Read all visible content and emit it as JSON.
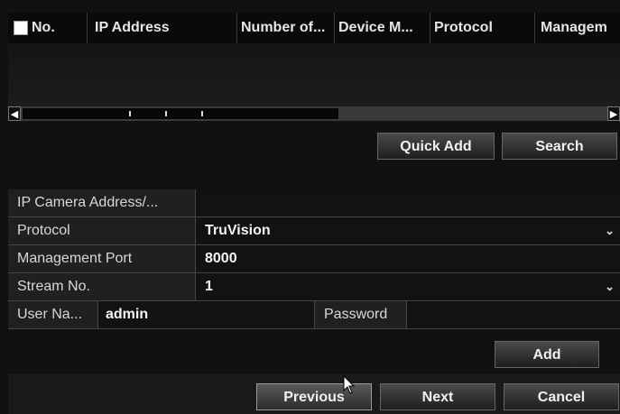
{
  "table": {
    "columns": [
      "No.",
      "IP Address",
      "Number of...",
      "Device M...",
      "Protocol",
      "Managem"
    ],
    "rows": []
  },
  "scroll": {
    "left_arrow": "◀",
    "right_arrow": "▶"
  },
  "actions": {
    "quick_add": "Quick Add",
    "search": "Search",
    "add": "Add"
  },
  "form": {
    "ip_label": "IP Camera Address/...",
    "ip_value": "",
    "protocol_label": "Protocol",
    "protocol_value": "TruVision",
    "mgmt_port_label": "Management Port",
    "mgmt_port_value": "8000",
    "stream_label": "Stream No.",
    "stream_value": "1",
    "user_label": "User Na...",
    "user_value": "admin",
    "password_label": "Password",
    "password_value": ""
  },
  "footer": {
    "previous": "Previous",
    "next": "Next",
    "cancel": "Cancel"
  },
  "icons": {
    "dropdown": "⌄"
  }
}
